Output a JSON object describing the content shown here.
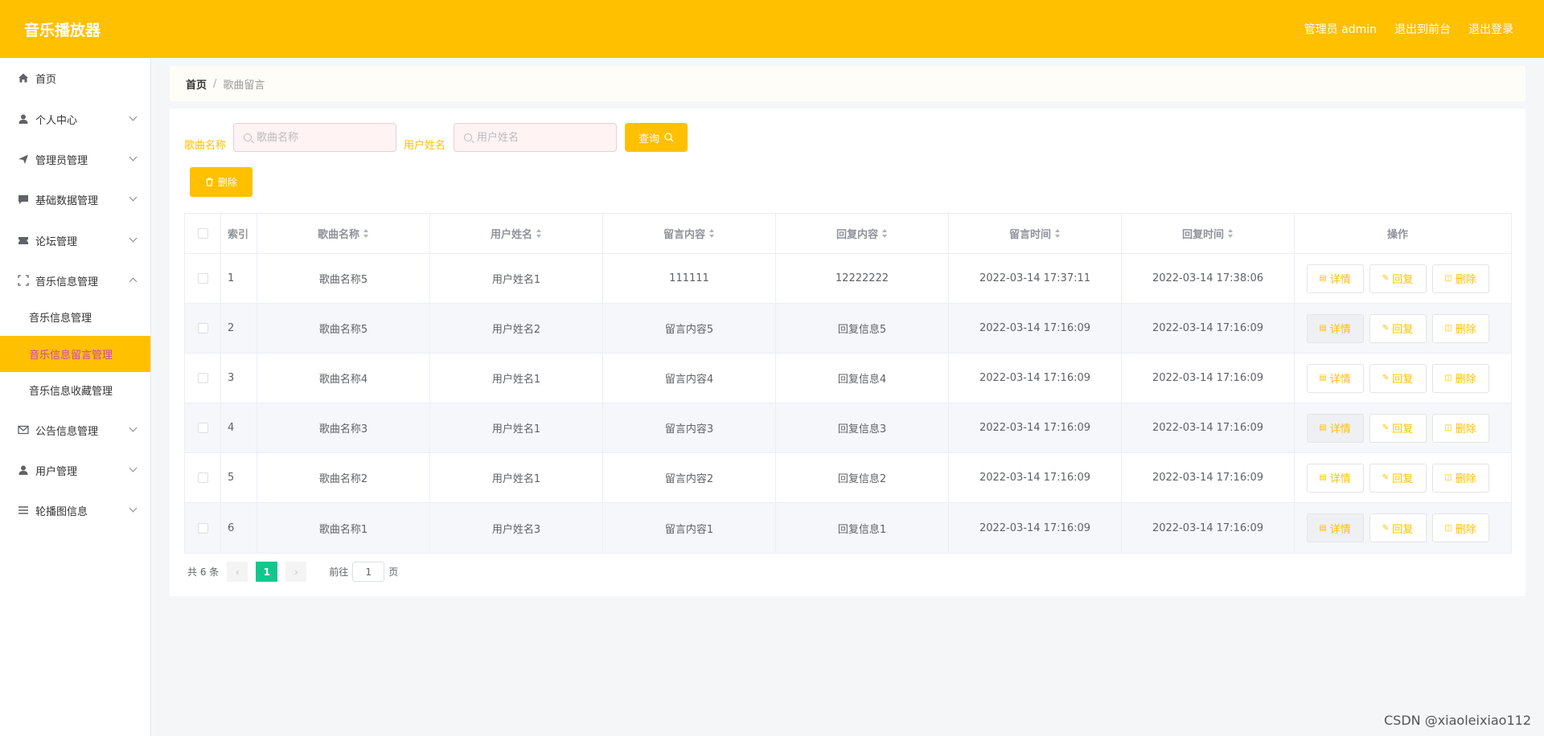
{
  "header": {
    "title": "音乐播放器",
    "admin_label": "管理员 admin",
    "back_front": "退出到前台",
    "logout": "退出登录"
  },
  "sidebar": {
    "items": [
      {
        "label": "首页",
        "icon": "home-icon"
      },
      {
        "label": "个人中心",
        "icon": "user-icon"
      },
      {
        "label": "管理员管理",
        "icon": "send-icon"
      },
      {
        "label": "基础数据管理",
        "icon": "chat-icon"
      },
      {
        "label": "论坛管理",
        "icon": "ticket-icon"
      },
      {
        "label": "音乐信息管理",
        "icon": "fullscreen-icon"
      },
      {
        "label": "音乐信息管理"
      },
      {
        "label": "音乐信息留言管理"
      },
      {
        "label": "音乐信息收藏管理"
      },
      {
        "label": "公告信息管理",
        "icon": "mail-icon"
      },
      {
        "label": "用户管理",
        "icon": "user-icon"
      },
      {
        "label": "轮播图信息",
        "icon": "list-icon"
      }
    ],
    "active_color": "#ffc000"
  },
  "breadcrumb": {
    "home": "首页",
    "sep": "/",
    "current": "歌曲留言"
  },
  "search": {
    "song_label": "歌曲名称",
    "song_placeholder": "歌曲名称",
    "user_label": "用户姓名",
    "user_placeholder": "用户姓名",
    "query_label": "查询"
  },
  "toolbar": {
    "delete_label": "删除"
  },
  "table": {
    "headers": [
      "索引",
      "歌曲名称",
      "用户姓名",
      "留言内容",
      "回复内容",
      "留言时间",
      "回复时间",
      "操作"
    ],
    "rows": [
      {
        "idx": "1",
        "song": "歌曲名称5",
        "user": "用户姓名1",
        "content": "111111",
        "reply": "12222222",
        "time": "2022-03-14 17:37:11",
        "reply_time": "2022-03-14 17:38:06"
      },
      {
        "idx": "2",
        "song": "歌曲名称5",
        "user": "用户姓名2",
        "content": "留言内容5",
        "reply": "回复信息5",
        "time": "2022-03-14 17:16:09",
        "reply_time": "2022-03-14 17:16:09"
      },
      {
        "idx": "3",
        "song": "歌曲名称4",
        "user": "用户姓名1",
        "content": "留言内容4",
        "reply": "回复信息4",
        "time": "2022-03-14 17:16:09",
        "reply_time": "2022-03-14 17:16:09"
      },
      {
        "idx": "4",
        "song": "歌曲名称3",
        "user": "用户姓名1",
        "content": "留言内容3",
        "reply": "回复信息3",
        "time": "2022-03-14 17:16:09",
        "reply_time": "2022-03-14 17:16:09"
      },
      {
        "idx": "5",
        "song": "歌曲名称2",
        "user": "用户姓名1",
        "content": "留言内容2",
        "reply": "回复信息2",
        "time": "2022-03-14 17:16:09",
        "reply_time": "2022-03-14 17:16:09"
      },
      {
        "idx": "6",
        "song": "歌曲名称1",
        "user": "用户姓名3",
        "content": "留言内容1",
        "reply": "回复信息1",
        "time": "2022-03-14 17:16:09",
        "reply_time": "2022-03-14 17:16:09"
      }
    ],
    "actions": {
      "detail": "详情",
      "reply": "回复",
      "delete": "删除"
    }
  },
  "pager": {
    "total": "共 6 条",
    "current": "1",
    "goto": "前往",
    "goto_value": "1",
    "page_unit": "页"
  },
  "watermark": "CSDN @xiaoleixiao112"
}
